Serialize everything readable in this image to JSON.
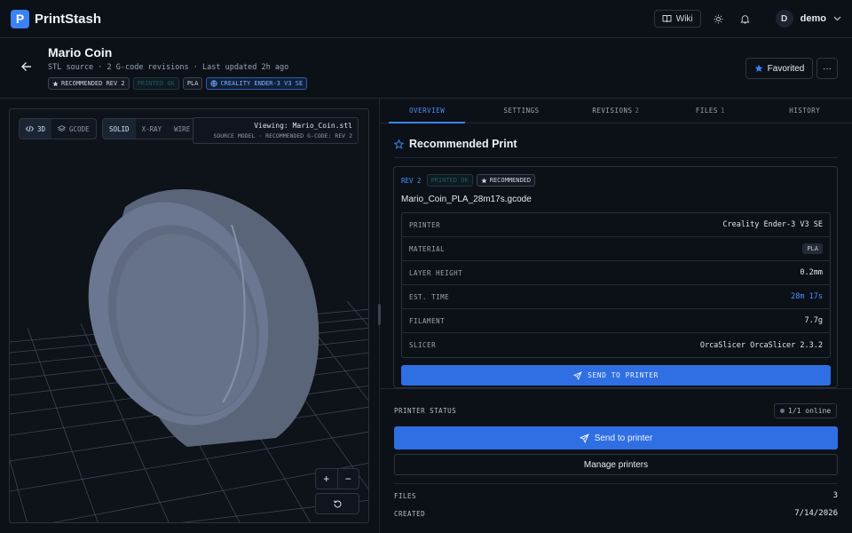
{
  "app": {
    "brand": "PrintStash",
    "logo_letter": "P",
    "wiki_label": "Wiki",
    "user_initial": "D",
    "user_name": "demo"
  },
  "model": {
    "title": "Mario Coin",
    "subtitle": "STL source · 2 G-code revisions · Last updated 2h ago",
    "tags": {
      "recommended": "RECOMMENDED REV 2",
      "printed": "PRINTED OK",
      "material": "PLA",
      "printer": "CREALITY ENDER-3 V3 SE"
    },
    "favorite_label": "Favorited",
    "more_label": "···"
  },
  "viewer": {
    "mode_3d": "3D",
    "mode_gcode": "GCODE",
    "render_solid": "SOLID",
    "render_xray": "X-RAY",
    "render_wire": "WIRE",
    "viewing": "Viewing: Mario_Coin.stl",
    "viewing_sub": "SOURCE MODEL · RECOMMENDED G-CODE: REV 2",
    "zoom_in": "+",
    "zoom_out": "−"
  },
  "tabs": [
    {
      "label": "OVERVIEW",
      "count": ""
    },
    {
      "label": "SETTINGS",
      "count": ""
    },
    {
      "label": "REVISIONS",
      "count": "2"
    },
    {
      "label": "FILES",
      "count": "1"
    },
    {
      "label": "HISTORY",
      "count": ""
    }
  ],
  "recommended": {
    "heading": "Recommended Print",
    "rev": "REV 2",
    "printed": "PRINTED OK",
    "badge": "RECOMMENDED",
    "filename": "Mario_Coin_PLA_28m17s.gcode",
    "rows": [
      {
        "key": "PRINTER",
        "value": "Creality Ender-3 V3 SE"
      },
      {
        "key": "MATERIAL",
        "value": "PLA"
      },
      {
        "key": "LAYER HEIGHT",
        "value": "0.2mm"
      },
      {
        "key": "EST. TIME",
        "value": "28m 17s"
      },
      {
        "key": "FILAMENT",
        "value": "7.7g"
      },
      {
        "key": "SLICER",
        "value": "OrcaSlicer OrcaSlicer 2.3.2"
      }
    ],
    "send_label": "SEND TO PRINTER"
  },
  "printer_status": {
    "label": "PRINTER STATUS",
    "online": "1/1 online",
    "send_label": "Send to printer",
    "manage_label": "Manage printers"
  },
  "meta": {
    "files_label": "FILES",
    "files_value": "3",
    "created_label": "CREATED",
    "created_value": "7/14/2026"
  },
  "colors": {
    "accent": "#3b82f6",
    "background": "#0c1118",
    "coin": "#6b7790"
  }
}
